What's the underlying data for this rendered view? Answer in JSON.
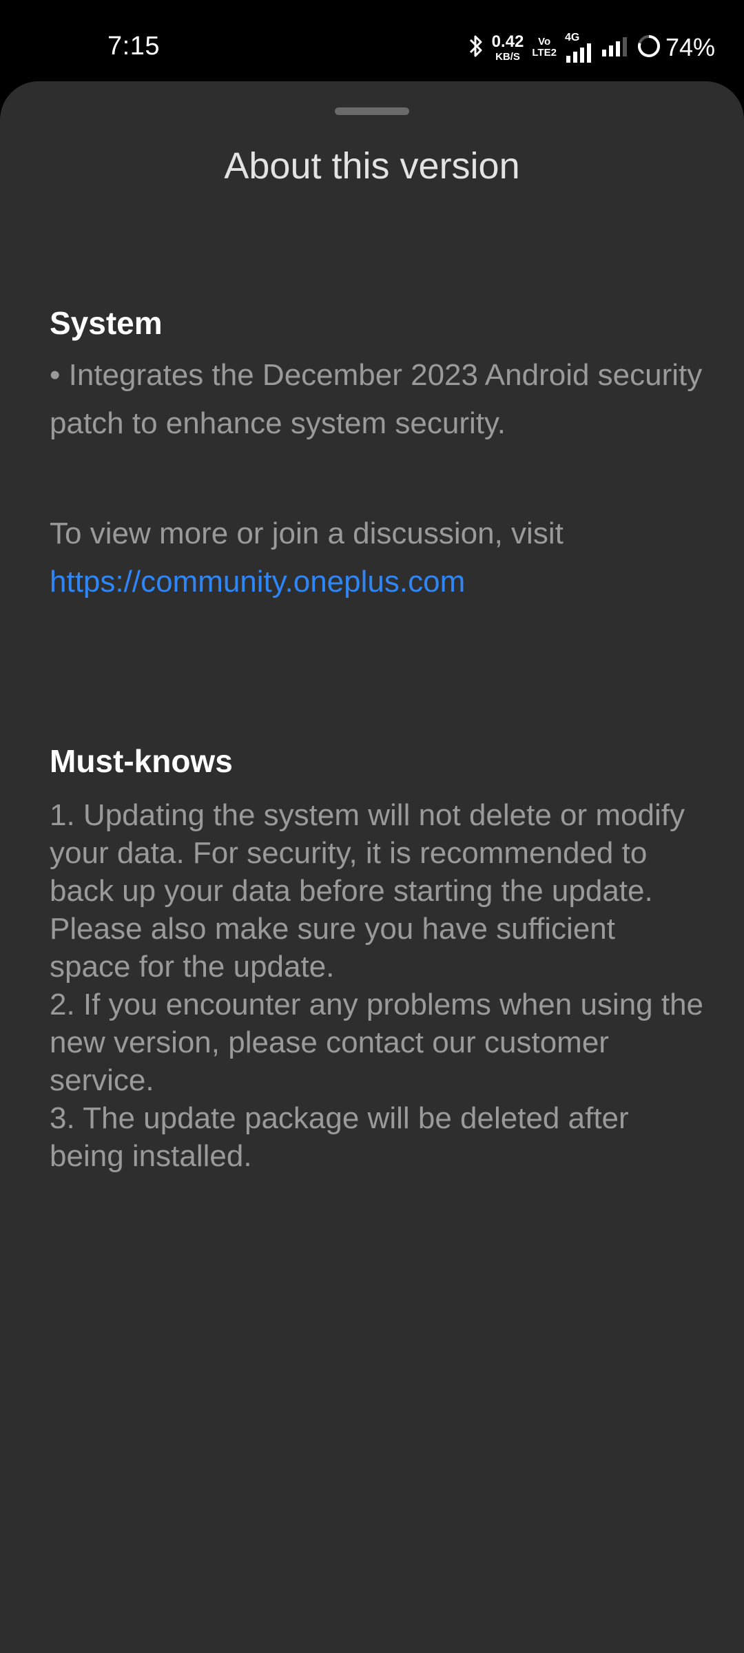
{
  "status_bar": {
    "time": "7:15",
    "net_speed_value": "0.42",
    "net_speed_unit": "KB/S",
    "volte_top": "Vo",
    "volte_bottom": "LTE2",
    "network_type": "4G",
    "battery_percent": "74%",
    "icons": [
      "bluetooth-icon",
      "volte-icon",
      "signal-4g-icon",
      "signal-bars-icon",
      "battery-ring-icon"
    ]
  },
  "sheet": {
    "title": "About this version",
    "system": {
      "heading": "System",
      "bullet": "• Integrates the December 2023 Android security patch to enhance system security.",
      "discussion_text": "To view more or join a discussion, visit",
      "link": "https://community.oneplus.com"
    },
    "must_knows": {
      "heading": "Must-knows",
      "items": [
        "1. Updating the system will not delete or modify your data. For security, it is recommended to back up your data before starting the update. Please also make sure you have sufficient space for the update.",
        "2. If you encounter any problems when using the new version, please contact our customer service.",
        "3. The update package will be deleted after being installed."
      ]
    }
  },
  "colors": {
    "background": "#000000",
    "sheet": "#2e2e2e",
    "heading": "#ffffff",
    "body_text": "#9a9a9a",
    "link": "#2f86f6"
  }
}
